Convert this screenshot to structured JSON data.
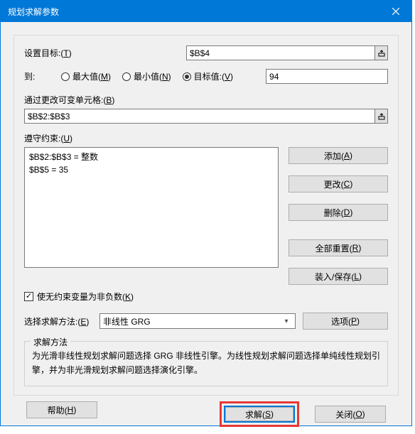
{
  "titlebar": {
    "title": "规划求解参数"
  },
  "target": {
    "label_prefix": "设置目标:(",
    "label_key": "T",
    "label_suffix": ")",
    "value": "$B$4"
  },
  "to": {
    "label": "到:",
    "options": {
      "max_prefix": "最大值(",
      "max_key": "M",
      "max_suffix": ")",
      "min_prefix": "最小值(",
      "min_key": "N",
      "min_suffix": ")",
      "val_prefix": "目标值:(",
      "val_key": "V",
      "val_suffix": ")"
    },
    "selected": "value",
    "value": "94"
  },
  "changing": {
    "label_prefix": "通过更改可变单元格:(",
    "label_key": "B",
    "label_suffix": ")",
    "value": "$B$2:$B$3"
  },
  "constraints": {
    "label_prefix": "遵守约束:(",
    "label_key": "U",
    "label_suffix": ")",
    "items": [
      "$B$2:$B$3 = 整数",
      "$B$5 = 35"
    ],
    "buttons": {
      "add_prefix": "添加(",
      "add_key": "A",
      "add_suffix": ")",
      "change_prefix": "更改(",
      "change_key": "C",
      "change_suffix": ")",
      "delete_prefix": "删除(",
      "delete_key": "D",
      "delete_suffix": ")",
      "reset_prefix": "全部重置(",
      "reset_key": "R",
      "reset_suffix": ")",
      "loadsave_prefix": "装入/保存(",
      "loadsave_key": "L",
      "loadsave_suffix": ")"
    }
  },
  "nonneg": {
    "checked": true,
    "label_prefix": "使无约束变量为非负数(",
    "label_key": "K",
    "label_suffix": ")"
  },
  "method": {
    "label_prefix": "选择求解方法:(",
    "label_key": "E",
    "label_suffix": ")",
    "selected": "非线性 GRG",
    "options_btn_prefix": "选项(",
    "options_btn_key": "P",
    "options_btn_suffix": ")"
  },
  "method_desc": {
    "title": "求解方法",
    "text": "为光滑非线性规划求解问题选择 GRG 非线性引擎。为线性规划求解问题选择单纯线性规划引擎，并为非光滑规划求解问题选择演化引擎。"
  },
  "footer": {
    "help_prefix": "帮助(",
    "help_key": "H",
    "help_suffix": ")",
    "solve_prefix": "求解(",
    "solve_key": "S",
    "solve_suffix": ")",
    "close_prefix": "关闭(",
    "close_key": "O",
    "close_suffix": ")"
  }
}
